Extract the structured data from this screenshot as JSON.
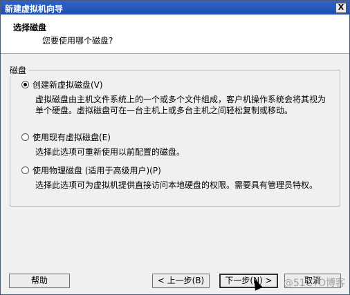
{
  "window": {
    "title": "新建虚拟机向导",
    "close_glyph": "X"
  },
  "header": {
    "title": "选择磁盘",
    "subtitle": "您要使用哪个磁盘?"
  },
  "disk_group": {
    "legend": "磁盘",
    "options": [
      {
        "label": "创建新虚拟磁盘(V)",
        "checked": true,
        "description_lines": [
          "虚拟磁盘由主机文件系统上的一个或多个文件组成，客户机操作系统会将其视为",
          "单个硬盘。虚拟磁盘可在一台主机上或多台主机之间轻松复制或移动。"
        ]
      },
      {
        "label": "使用现有虚拟磁盘(E)",
        "checked": false,
        "description_lines": [
          "选择此选项可重新使用以前配置的磁盘。"
        ]
      },
      {
        "label": "使用物理磁盘 (适用于高级用户)(P)",
        "checked": false,
        "description_lines": [
          "选择此选项可为虚拟机提供直接访问本地硬盘的权限。需要具有管理员特权。"
        ]
      }
    ]
  },
  "buttons": {
    "help": "帮助",
    "back": "< 上一步(B)",
    "next": "下一步(N) >",
    "cancel": "取消"
  },
  "watermark": "@51CTO博客"
}
